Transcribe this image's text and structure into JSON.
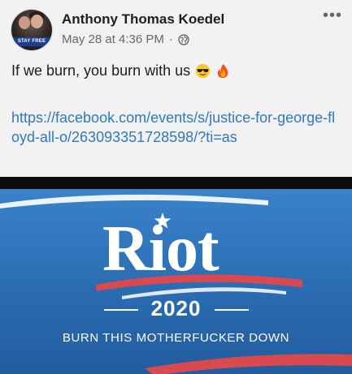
{
  "post": {
    "author": "Anthony Thomas Koedel",
    "timestamp": "May 28 at 4:36 PM",
    "separator": "·",
    "privacy_icon": "globe-icon",
    "more_icon": "more-options-icon",
    "text": "If we burn, you burn with us",
    "emojis": [
      "sunglasses-emoji",
      "fire-emoji"
    ],
    "link": "https://facebook.com/events/s/justice-for-george-floyd-all-o/263093351728598/?ti=as"
  },
  "avatar": {
    "badge_text": "STAY FREE"
  },
  "image": {
    "headline": "Riot",
    "year": "2020",
    "tagline": "BURN THIS MOTHERFUCKER DOWN",
    "colors": {
      "background": "#2f74ba",
      "stripe": "#d84a4f",
      "text": "#ffffff"
    }
  }
}
